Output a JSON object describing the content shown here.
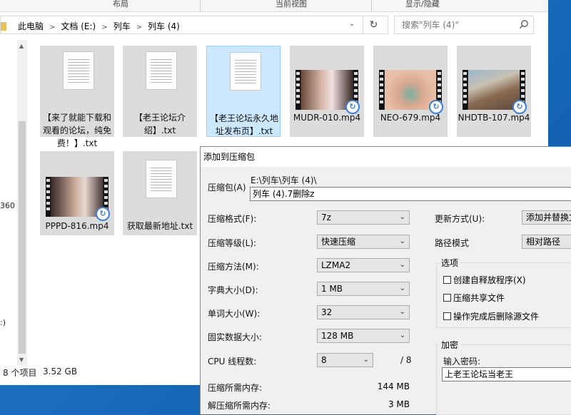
{
  "explorer": {
    "ribbon_tabs": [
      "布局",
      "当前视图",
      "显示/隐藏"
    ],
    "breadcrumb": [
      "此电脑",
      "文档 (E:)",
      "列车",
      "列车 (4)"
    ],
    "search_placeholder": "搜索\"列车 (4)\"",
    "nav_texts": [
      "360",
      ":)"
    ],
    "status": {
      "items": "8 个项目",
      "size": "3.52 GB"
    },
    "files": [
      {
        "name": "【来了就能下载和观看的论坛，纯免费！】.txt",
        "type": "txt",
        "selected": false
      },
      {
        "name": "【老王论坛介绍】.txt",
        "type": "txt",
        "selected": false
      },
      {
        "name": "【老王论坛永久地址发布页】.txt",
        "type": "txt",
        "selected": true
      },
      {
        "name": "MUDR-010.mp4",
        "type": "video",
        "selected": false
      },
      {
        "name": "NEO-679.mp4",
        "type": "video",
        "selected": false
      },
      {
        "name": "NHDTB-107.mp4",
        "type": "video",
        "selected": false
      },
      {
        "name": "PPPD-816.mp4",
        "type": "video",
        "selected": false
      },
      {
        "name": "获取最新地址.txt",
        "type": "txt",
        "selected": false
      }
    ]
  },
  "dialog": {
    "title": "添加到压缩包",
    "archive_label": "压缩包(A)",
    "archive_path": "E:\\列车\\列车 (4)\\",
    "archive_name": "列车 (4).7删除z",
    "format_label": "压缩格式(F):",
    "format_value": "7z",
    "level_label": "压缩等级(L):",
    "level_value": "快速压缩",
    "method_label": "压缩方法(M):",
    "method_value": "LZMA2",
    "dict_label": "字典大小(D):",
    "dict_value": "1 MB",
    "word_label": "单词大小(W):",
    "word_value": "32",
    "solid_label": "固实数据大小:",
    "solid_value": "128 MB",
    "cpu_label": "CPU 线程数:",
    "cpu_value": "8",
    "cpu_max": "/ 8",
    "mem_comp_label": "压缩所需内存:",
    "mem_comp_value": "144 MB",
    "mem_decomp_label": "解压缩所需内存:",
    "mem_decomp_value": "3 MB",
    "update_label": "更新方式(U):",
    "update_value": "添加并替换文",
    "path_label": "路径模式",
    "path_value": "相对路径",
    "options_title": "选项",
    "opt_sfx": "创建自释放程序(X)",
    "opt_shared": "压缩共享文件",
    "opt_delete": "操作完成后删除源文件",
    "encrypt_title": "加密",
    "password_label": "输入密码:",
    "password_value": "上老王论坛当老王"
  }
}
